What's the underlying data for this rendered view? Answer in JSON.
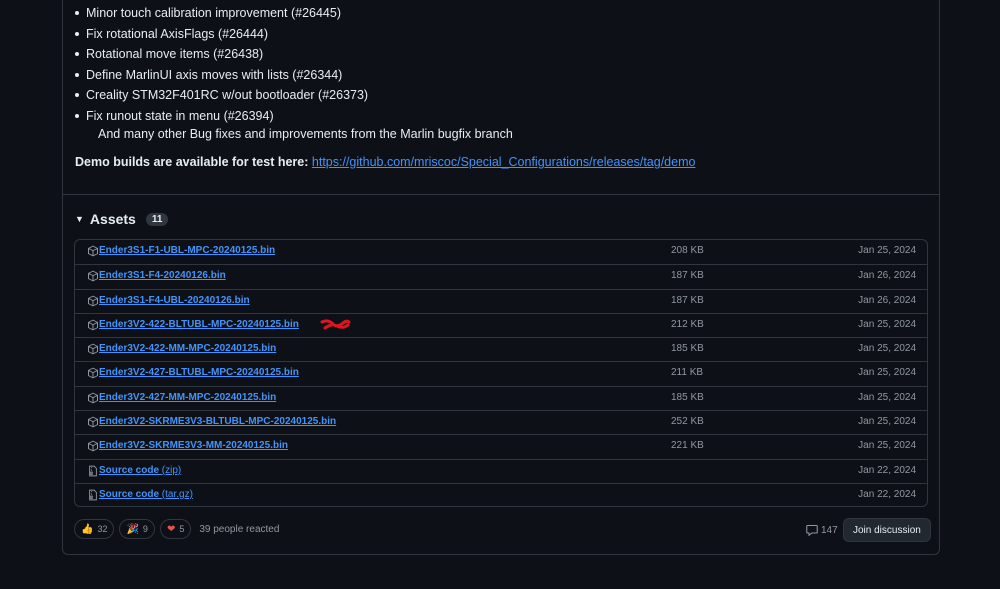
{
  "release_notes": {
    "bullets": [
      "Minor touch calibration improvement (#26445)",
      "Fix rotational AxisFlags (#26444)",
      "Rotational move items (#26438)",
      "Define MarlinUI axis moves with lists (#26344)",
      "Creality STM32F401RC w/out bootloader (#26373)",
      "Fix runout state in menu (#26394)"
    ],
    "extra_line": "And many other Bug fixes and improvements from the Marlin bugfix branch",
    "demo_label": "Demo builds are available for test here:",
    "demo_link": "https://github.com/mriscoc/Special_Configurations/releases/tag/demo"
  },
  "assets": {
    "title": "Assets",
    "count": "11",
    "items": [
      {
        "name": "Ender3S1-F1-UBL-MPC-20240125.bin",
        "ext": "",
        "size": "208 KB",
        "date": "Jan 25, 2024",
        "icon": "package-icon"
      },
      {
        "name": "Ender3S1-F4-20240126.bin",
        "ext": "",
        "size": "187 KB",
        "date": "Jan 26, 2024",
        "icon": "package-icon"
      },
      {
        "name": "Ender3S1-F4-UBL-20240126.bin",
        "ext": "",
        "size": "187 KB",
        "date": "Jan 26, 2024",
        "icon": "package-icon"
      },
      {
        "name": "Ender3V2-422-BLTUBL-MPC-20240125.bin",
        "ext": "",
        "size": "212 KB",
        "date": "Jan 25, 2024",
        "icon": "package-icon"
      },
      {
        "name": "Ender3V2-422-MM-MPC-20240125.bin",
        "ext": "",
        "size": "185 KB",
        "date": "Jan 25, 2024",
        "icon": "package-icon"
      },
      {
        "name": "Ender3V2-427-BLTUBL-MPC-20240125.bin",
        "ext": "",
        "size": "211 KB",
        "date": "Jan 25, 2024",
        "icon": "package-icon"
      },
      {
        "name": "Ender3V2-427-MM-MPC-20240125.bin",
        "ext": "",
        "size": "185 KB",
        "date": "Jan 25, 2024",
        "icon": "package-icon"
      },
      {
        "name": "Ender3V2-SKRME3V3-BLTUBL-MPC-20240125.bin",
        "ext": "",
        "size": "252 KB",
        "date": "Jan 25, 2024",
        "icon": "package-icon"
      },
      {
        "name": "Ender3V2-SKRME3V3-MM-20240125.bin",
        "ext": "",
        "size": "221 KB",
        "date": "Jan 25, 2024",
        "icon": "package-icon"
      },
      {
        "name": "Source code",
        "ext": " (zip)",
        "size": "",
        "date": "Jan 22, 2024",
        "icon": "file-zip-icon"
      },
      {
        "name": "Source code",
        "ext": " (tar.gz)",
        "size": "",
        "date": "Jan 22, 2024",
        "icon": "file-zip-icon"
      }
    ]
  },
  "reactions": {
    "items": [
      {
        "emoji": "👍",
        "count": "32",
        "icon": "thumbs-up-icon"
      },
      {
        "emoji": "🎉",
        "count": "9",
        "icon": "party-icon"
      },
      {
        "emoji": "❤",
        "count": "5",
        "icon": "heart-icon"
      }
    ],
    "summary": "39 people reacted"
  },
  "discussion": {
    "comment_count": "147",
    "join_label": "Join discussion"
  },
  "colors": {
    "background": "#0d1117",
    "border": "#30363d",
    "link": "#4493f8",
    "muted": "#9198a1",
    "scribble": "#e0141e"
  }
}
